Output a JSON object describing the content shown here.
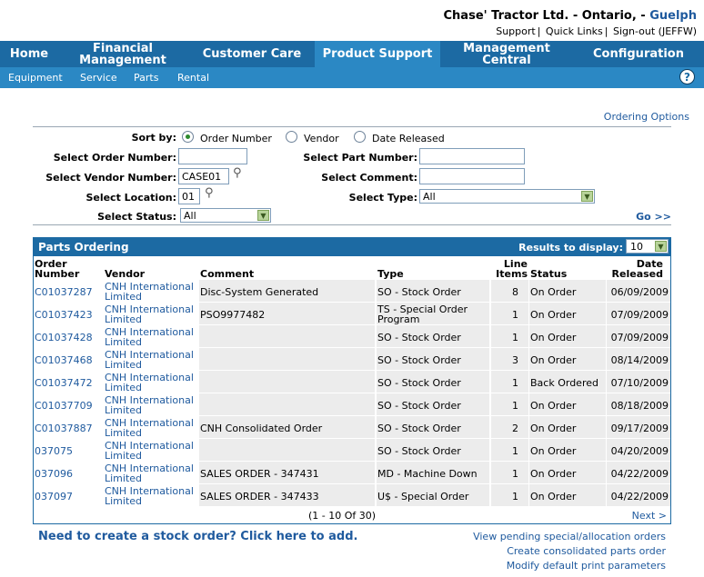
{
  "header": {
    "company": "Chase' Tractor Ltd. - Ontario, -",
    "location": "Guelph",
    "links": [
      "Support",
      "Quick Links",
      "Sign-out (JEFFW)"
    ]
  },
  "nav": {
    "tabs": [
      "Home",
      "Financial Management",
      "Customer Care",
      "Product Support",
      "Management Central",
      "Configuration"
    ],
    "active": "Product Support",
    "subtabs": [
      "Equipment",
      "Service",
      "Parts",
      "Rental"
    ],
    "help_label": "?"
  },
  "search": {
    "ordering_options": "Ordering Options",
    "sort_by_label": "Sort by:",
    "sort_options": [
      "Order Number",
      "Vendor",
      "Date Released"
    ],
    "sort_selected": "Order Number",
    "order_number_label": "Select Order Number:",
    "order_number_value": "",
    "part_number_label": "Select Part Number:",
    "part_number_value": "",
    "vendor_number_label": "Select Vendor Number:",
    "vendor_number_value": "CASE01",
    "comment_label": "Select Comment:",
    "comment_value": "",
    "location_label": "Select Location:",
    "location_value": "01",
    "type_label": "Select Type:",
    "type_value": "All",
    "status_label": "Select Status:",
    "status_value": "All",
    "go_label": "Go >>"
  },
  "grid": {
    "title": "Parts Ordering",
    "results_label": "Results to display:",
    "results_value": "10",
    "columns": {
      "order_l1": "Order",
      "order_l2": "Number",
      "vendor": "Vendor",
      "comment": "Comment",
      "type": "Type",
      "items_l1": "Line",
      "items_l2": "Items",
      "status": "Status",
      "date_l1": "Date",
      "date_l2": "Released"
    },
    "rows": [
      {
        "order": "C01037287",
        "vendor1": "CNH International",
        "vendor2": "Limited",
        "comment": "Disc-System Generated",
        "type1": "SO - Stock Order",
        "type2": "",
        "items": "8",
        "status": "On Order",
        "date": "06/09/2009"
      },
      {
        "order": "C01037423",
        "vendor1": "CNH International",
        "vendor2": "Limited",
        "comment": "PSO9977482",
        "type1": "TS - Special Order",
        "type2": "Program",
        "items": "1",
        "status": "On Order",
        "date": "07/09/2009"
      },
      {
        "order": "C01037428",
        "vendor1": "CNH International",
        "vendor2": "Limited",
        "comment": "",
        "type1": "SO - Stock Order",
        "type2": "",
        "items": "1",
        "status": "On Order",
        "date": "07/09/2009"
      },
      {
        "order": "C01037468",
        "vendor1": "CNH International",
        "vendor2": "Limited",
        "comment": "",
        "type1": "SO - Stock Order",
        "type2": "",
        "items": "3",
        "status": "On Order",
        "date": "08/14/2009"
      },
      {
        "order": "C01037472",
        "vendor1": "CNH International",
        "vendor2": "Limited",
        "comment": "",
        "type1": "SO - Stock Order",
        "type2": "",
        "items": "1",
        "status": "Back Ordered",
        "date": "07/10/2009"
      },
      {
        "order": "C01037709",
        "vendor1": "CNH International",
        "vendor2": "Limited",
        "comment": "",
        "type1": "SO - Stock Order",
        "type2": "",
        "items": "1",
        "status": "On Order",
        "date": "08/18/2009"
      },
      {
        "order": "C01037887",
        "vendor1": "CNH International",
        "vendor2": "Limited",
        "comment": "CNH Consolidated Order",
        "type1": "SO - Stock Order",
        "type2": "",
        "items": "2",
        "status": "On Order",
        "date": "09/17/2009"
      },
      {
        "order": "037075",
        "vendor1": "CNH International",
        "vendor2": "Limited",
        "comment": "",
        "type1": "SO - Stock Order",
        "type2": "",
        "items": "1",
        "status": "On Order",
        "date": "04/20/2009"
      },
      {
        "order": "037096",
        "vendor1": "CNH International",
        "vendor2": "Limited",
        "comment": "SALES ORDER - 347431",
        "type1": "MD - Machine Down",
        "type2": "",
        "items": "1",
        "status": "On Order",
        "date": "04/22/2009"
      },
      {
        "order": "037097",
        "vendor1": "CNH International",
        "vendor2": "Limited",
        "comment": "SALES ORDER - 347433",
        "type1": "U$ - Special Order",
        "type2": "",
        "items": "1",
        "status": "On Order",
        "date": "04/22/2009"
      }
    ],
    "pager_text": "(1  -  10  Of  30)",
    "next_label": "Next >"
  },
  "footer": {
    "create_stock": "Need to create a stock order? Click here to add.",
    "links": [
      "View pending special/allocation orders",
      "Create consolidated parts order",
      "Modify default print parameters"
    ]
  }
}
